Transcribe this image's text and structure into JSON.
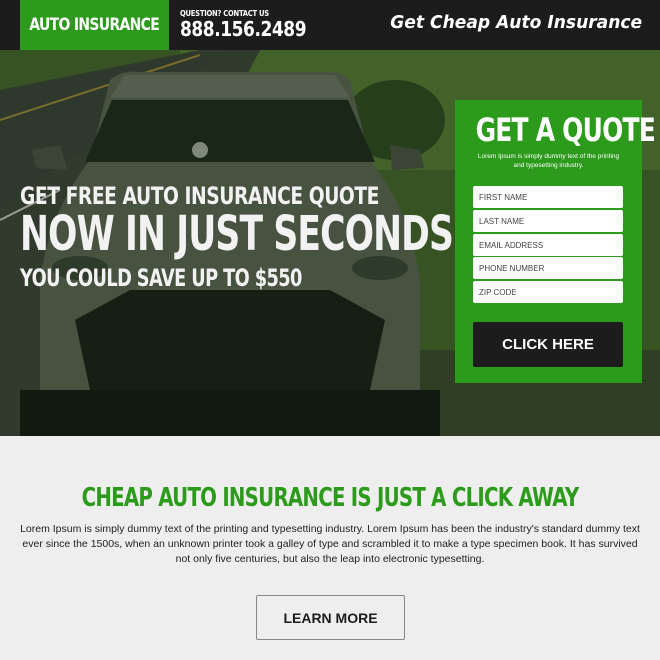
{
  "header": {
    "logo": "AUTO INSURANCE",
    "contact_label": "QUESTION? CONTACT US",
    "phone": "888.156.2489",
    "tagline": "Get Cheap Auto Insurance"
  },
  "hero": {
    "line1": "GET FREE AUTO INSURANCE QUOTE",
    "line2": "NOW IN JUST SECONDS",
    "line3": "YOU COULD SAVE UP TO $550",
    "image": "car-on-road-photo"
  },
  "quote_form": {
    "title": "GET A QUOTE",
    "subtitle": "Lorem Ipsum is simply dummy text of the printing and typesetting industry.",
    "fields": [
      {
        "placeholder": "FIRST NAME",
        "value": ""
      },
      {
        "placeholder": "LAST NAME",
        "value": ""
      },
      {
        "placeholder": "EMAIL ADDRESS",
        "value": ""
      },
      {
        "placeholder": "PHONE NUMBER",
        "value": ""
      },
      {
        "placeholder": "ZIP CODE",
        "value": ""
      }
    ],
    "submit_label": "CLICK HERE"
  },
  "info": {
    "title": "CHEAP AUTO INSURANCE IS JUST A CLICK AWAY",
    "body": "Lorem Ipsum is simply dummy text of the printing and typesetting industry. Lorem Ipsum has been the industry's standard dummy text ever since the 1500s, when an unknown printer took a galley of type and scrambled it to make a type specimen book. It has survived not only five centuries, but also the leap into electronic typesetting.",
    "button_label": "LEARN MORE"
  },
  "colors": {
    "brand_green": "#2c9a1b",
    "dark": "#1c1c1c",
    "light_bg": "#eeeeee"
  }
}
